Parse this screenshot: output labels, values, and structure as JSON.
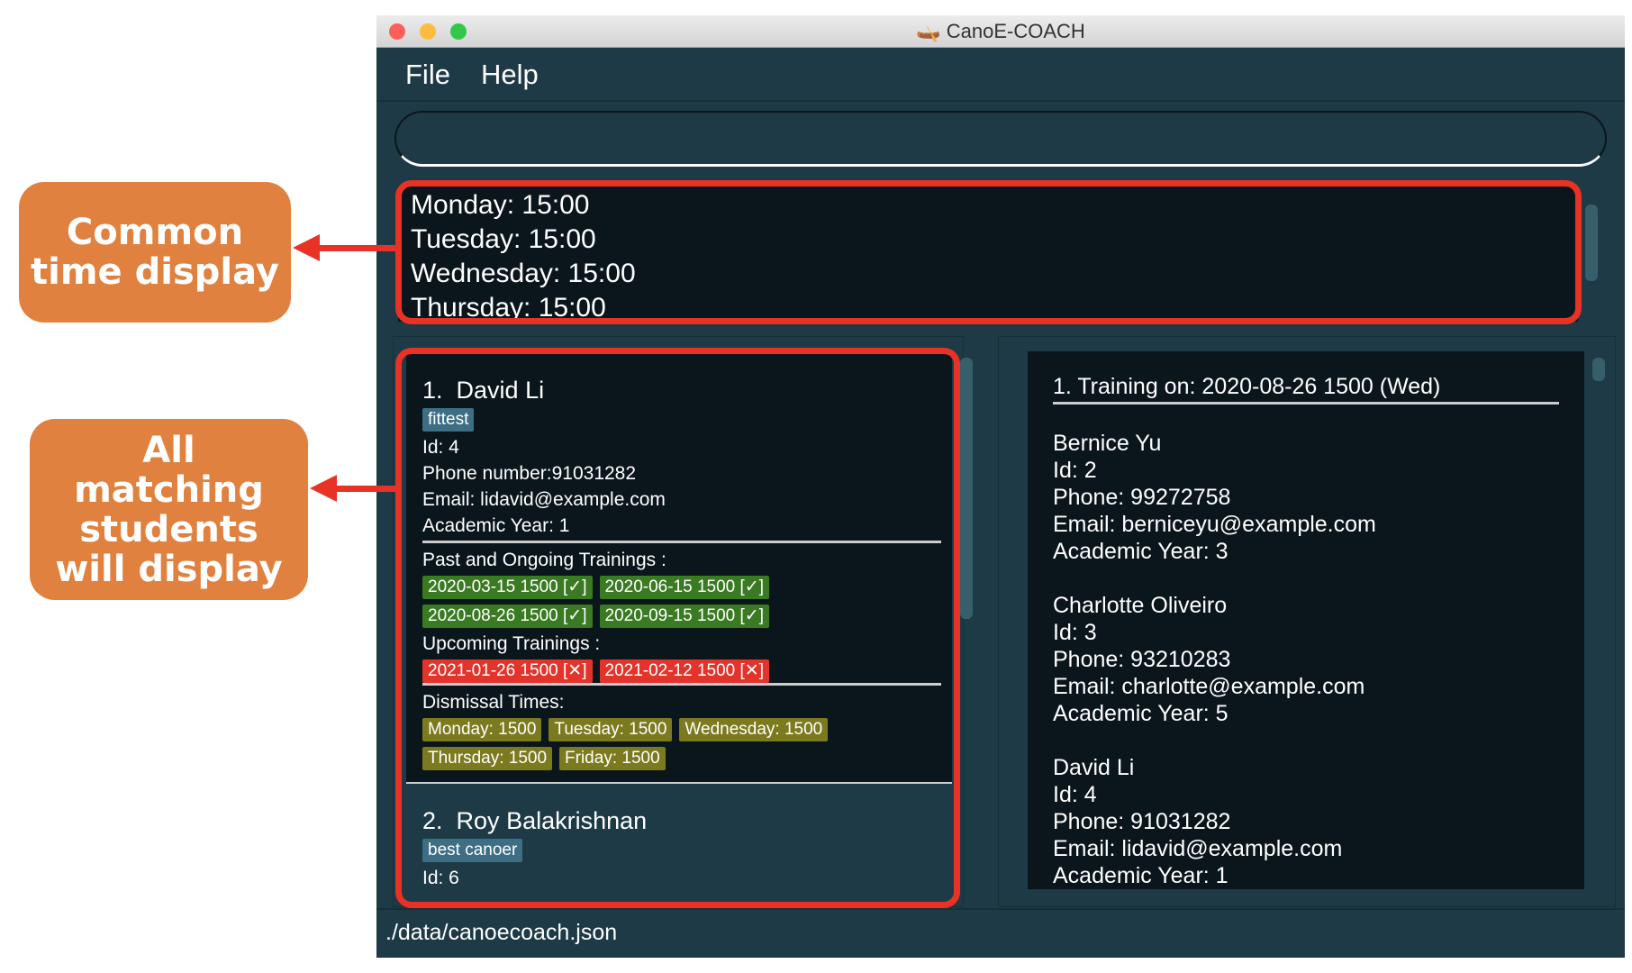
{
  "window": {
    "title": "CanoE-COACH",
    "icon": "canoe-icon"
  },
  "menu": [
    {
      "label": "File"
    },
    {
      "label": "Help"
    }
  ],
  "command_box": {
    "value": "",
    "placeholder": ""
  },
  "result_display": [
    "Monday: 15:00",
    "Tuesday: 15:00",
    "Wednesday: 15:00",
    "Thursday: 15:00"
  ],
  "students": [
    {
      "index": "1.",
      "name": "David Li",
      "tag": "fittest",
      "id": "Id: 4",
      "phone": "Phone number:91031282",
      "email": "Email: lidavid@example.com",
      "year": "Academic Year: 1",
      "past_label": "Past and Ongoing Trainings :",
      "past": [
        "2020-03-15 1500 [✓]",
        "2020-06-15 1500 [✓]",
        "2020-08-26 1500 [✓]",
        "2020-09-15 1500 [✓]"
      ],
      "upcoming_label": "Upcoming Trainings :",
      "upcoming": [
        "2021-01-26 1500 [✕]",
        "2021-02-12 1500 [✕]"
      ],
      "dismissal_label": "Dismissal Times:",
      "dismissal": [
        "Monday: 1500",
        "Tuesday: 1500",
        "Wednesday: 1500",
        "Thursday: 1500",
        "Friday: 1500"
      ]
    },
    {
      "index": "2.",
      "name": "Roy Balakrishnan",
      "tag": "best canoer",
      "id": "Id: 6"
    }
  ],
  "training": {
    "heading": "1.  Training on: 2020-08-26 1500 (Wed)",
    "attendees": [
      [
        "Bernice Yu",
        "Id: 2",
        "Phone: 99272758",
        "Email: berniceyu@example.com",
        "Academic  Year: 3"
      ],
      [
        "Charlotte Oliveiro",
        "Id: 3",
        "Phone: 93210283",
        "Email: charlotte@example.com",
        "Academic  Year: 5"
      ],
      [
        "David Li",
        "Id: 4",
        "Phone: 91031282",
        "Email: lidavid@example.com",
        "Academic  Year: 1"
      ]
    ]
  },
  "status_bar": "./data/canoecoach.json",
  "annotations": {
    "common_time": "Common time display",
    "matching": "All matching students will display"
  },
  "colors": {
    "accent_red": "#e83225",
    "callout": "#e0813f",
    "past_tag": "#3a7a22",
    "upcoming_tag": "#e3342b",
    "dismissal_tag": "#7c7a1f",
    "tag": "#3d6e84"
  }
}
